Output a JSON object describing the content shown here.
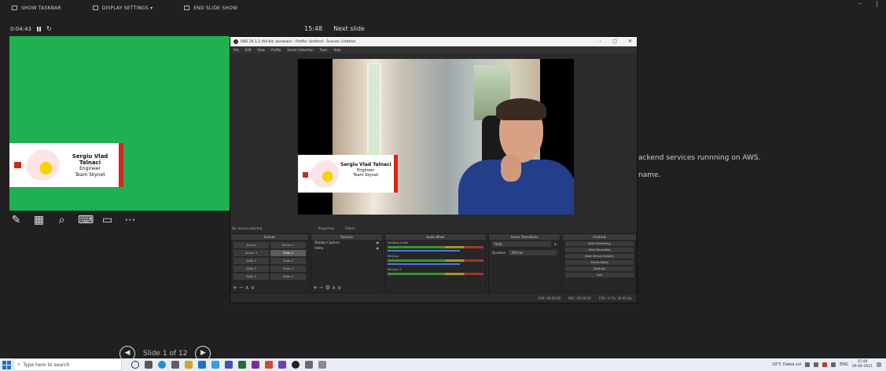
{
  "presenter": {
    "toolbar": {
      "show_taskbar": "SHOW TASKBAR",
      "display_settings": "DISPLAY SETTINGS ▾",
      "end_slide_show": "END SLIDE SHOW"
    },
    "timer": "0:04:43",
    "clock": "15:48",
    "next_slide_label": "Next slide",
    "slide_counter": "Slide 1 of 12",
    "notes": [
      "ackend services runnning on AWS.",
      "name."
    ],
    "annotation_tools": [
      "pen-icon",
      "slides-grid-icon",
      "zoom-icon",
      "pointer-screen-icon",
      "subtitles-icon",
      "more-icon"
    ]
  },
  "name_card": {
    "name": "Sergiu Vlad Talnaci",
    "role": "Engineer",
    "team": "Team Skynet"
  },
  "obs": {
    "title": "OBS 26.1.2 (64-bit, windows) - Profile: Untitled - Scenes: Untitled",
    "menu": [
      "File",
      "Edit",
      "View",
      "Profile",
      "Scene Collection",
      "Tools",
      "Help"
    ],
    "status_left": "No source selected",
    "status_mid": [
      "Properties",
      "Filters"
    ],
    "docks": {
      "scenes_title": "Scenes",
      "scenes": [
        "Scene",
        "Scene 2",
        "Scene 3",
        "Slide 0",
        "Slide 1",
        "Slide 2",
        "Slide 3",
        "Slide 4",
        "Slide 5",
        "Slide 5"
      ],
      "sources_title": "Sources",
      "sources": [
        "Display Capture",
        "Video"
      ],
      "mixer_title": "Audio Mixer",
      "mixer": [
        "Desktop Audio",
        "Mic/Aux",
        "Mic/Aux 2"
      ],
      "transitions_title": "Scene Transitions",
      "transition": "Fade",
      "duration_label": "Duration",
      "duration": "300 ms",
      "controls_title": "Controls",
      "controls": [
        "Start Streaming",
        "Start Recording",
        "Start Virtual Camera",
        "Studio Mode",
        "Settings",
        "Exit"
      ]
    },
    "status_bar": [
      "LIVE: 00:00:00",
      "REC: 00:00:00",
      "CPU: 0.7%, 30.00 fps"
    ]
  },
  "taskbar": {
    "search_placeholder": "Type here to search",
    "weather": "20°C Dalea sol",
    "language": "ENG",
    "time": "15:48",
    "date": "09-06-2021"
  },
  "colors": {
    "slide_green": "#1eb152",
    "accent_red": "#d6261b",
    "background": "#202020"
  }
}
